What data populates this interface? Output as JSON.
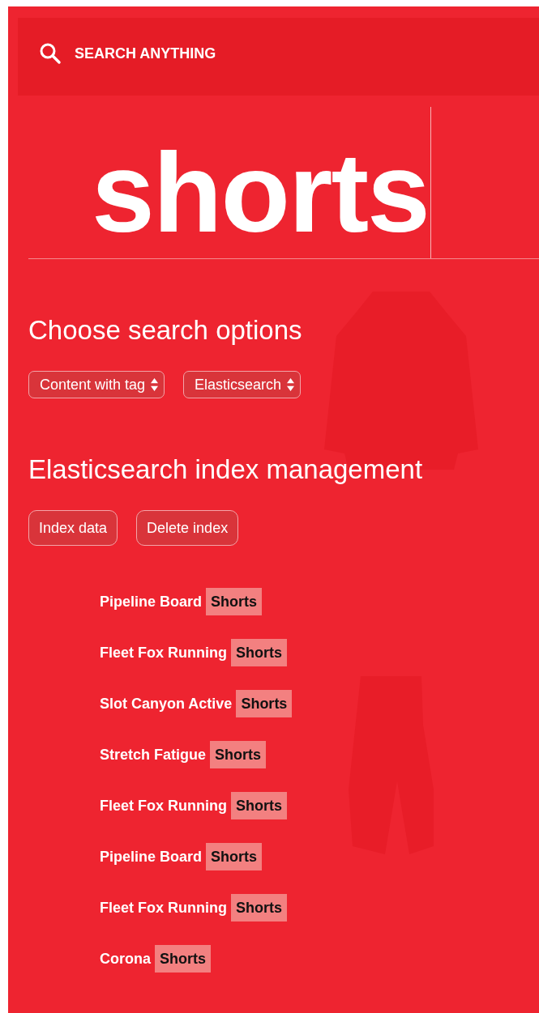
{
  "search_bar": {
    "label": "SEARCH ANYTHING"
  },
  "query": {
    "value": "shorts"
  },
  "options": {
    "title": "Choose search options",
    "selects": [
      {
        "value": "Content with tag"
      },
      {
        "value": "Elasticsearch"
      }
    ]
  },
  "index_management": {
    "title": "Elasticsearch index management",
    "buttons": [
      "Index data",
      "Delete index"
    ]
  },
  "results": [
    {
      "title": "Pipeline Board",
      "match": "Shorts"
    },
    {
      "title": "Fleet Fox Running",
      "match": "Shorts"
    },
    {
      "title": "Slot Canyon Active",
      "match": "Shorts"
    },
    {
      "title": "Stretch Fatigue",
      "match": "Shorts"
    },
    {
      "title": "Fleet Fox Running",
      "match": "Shorts"
    },
    {
      "title": "Pipeline Board",
      "match": "Shorts"
    },
    {
      "title": "Fleet Fox Running",
      "match": "Shorts"
    },
    {
      "title": "Corona",
      "match": "Shorts"
    }
  ]
}
